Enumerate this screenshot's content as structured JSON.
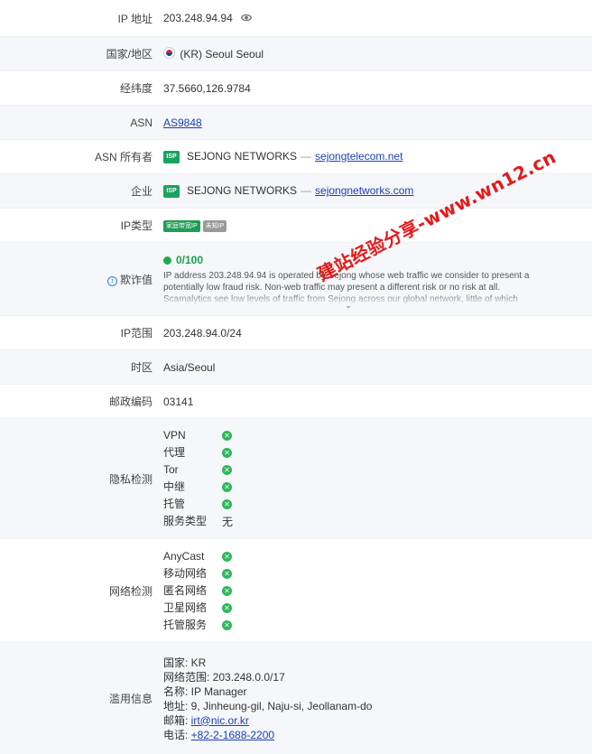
{
  "ip": {
    "label": "IP 地址",
    "value": "203.248.94.94",
    "icon": "eye-icon"
  },
  "country": {
    "label": "国家/地区",
    "value": "(KR) Seoul Seoul"
  },
  "coords": {
    "label": "经纬度",
    "value": "37.5660,126.9784"
  },
  "asn": {
    "label": "ASN",
    "value": "AS9848"
  },
  "asn_owner": {
    "label": "ASN 所有者",
    "badge": "ISP",
    "name": "SEJONG NETWORKS",
    "sep": "—",
    "link": "sejongtelecom.net"
  },
  "company": {
    "label": "企业",
    "badge": "ISP",
    "name": "SEJONG NETWORKS",
    "sep": "—",
    "link": "sejongnetworks.com"
  },
  "ip_type": {
    "label": "IP类型",
    "tags": [
      "家庭带宽IP",
      "未知IP"
    ]
  },
  "fraud": {
    "label": "欺诈值",
    "score": "0/100",
    "score_color": "#1a9f4b",
    "description": "IP address 203.248.94.94 is operated by Sejong whose web traffic we consider to present a potentially low fraud risk. Non-web traffic may present a different risk or no risk at all. Scamalytics see low levels of traffic from Sejong across our global network, little of which",
    "expand_icon": "chevron-down-icon"
  },
  "ip_range": {
    "label": "IP范围",
    "value": "203.248.94.0/24"
  },
  "timezone": {
    "label": "时区",
    "value": "Asia/Seoul"
  },
  "postal": {
    "label": "邮政编码",
    "value": "03141"
  },
  "privacy": {
    "label": "隐私检测",
    "items": [
      {
        "name": "VPN",
        "status": "no"
      },
      {
        "name": "代理",
        "status": "no"
      },
      {
        "name": "Tor",
        "status": "no"
      },
      {
        "name": "中继",
        "status": "no"
      },
      {
        "name": "托管",
        "status": "no"
      }
    ],
    "service_type_label": "服务类型",
    "service_type_value": "无"
  },
  "network": {
    "label": "网络检测",
    "items": [
      {
        "name": "AnyCast",
        "status": "no"
      },
      {
        "name": "移动网络",
        "status": "no"
      },
      {
        "name": "匿名网络",
        "status": "no"
      },
      {
        "name": "卫星网络",
        "status": "no"
      },
      {
        "name": "托管服务",
        "status": "no"
      }
    ]
  },
  "abuse": {
    "label": "滥用信息",
    "country": "国家: KR",
    "range": "网络范围: 203.248.0.0/17",
    "name": "名称: IP Manager",
    "address": "地址: 9, Jinheung-gil, Naju-si, Jeollanam-do",
    "email_label": "邮箱: ",
    "email": "irt@nic.or.kr",
    "phone_label": "电话: ",
    "phone": "+82-2-1688-2200"
  },
  "watermark": "建站经验分享-www.wn12.cn",
  "colors": {
    "accent_green": "#1aa260",
    "check_green": "#2eb85c",
    "link_blue": "#1a3fb8",
    "watermark_red": "#e31b1b"
  }
}
